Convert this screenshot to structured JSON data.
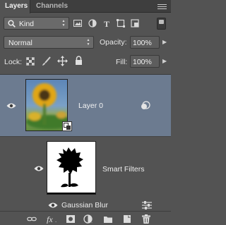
{
  "tabs": [
    {
      "label": "Layers"
    },
    {
      "label": "Channels"
    }
  ],
  "filter": {
    "kind_label": "Kind",
    "icon": "search-icon"
  },
  "blend": {
    "mode": "Normal",
    "opacity_label": "Opacity:",
    "opacity_value": "100%"
  },
  "lock": {
    "label": "Lock:",
    "fill_label": "Fill:",
    "fill_value": "100%"
  },
  "layers": [
    {
      "name": "Layer 0",
      "type": "smart-object",
      "selected": true
    }
  ],
  "smart_filters": {
    "label": "Smart Filters",
    "filters": [
      {
        "name": "Gaussian Blur"
      }
    ]
  },
  "colors": {
    "panel": "#535353",
    "selected_row": "#6c7b90",
    "tab_bar": "#3e3e3e"
  }
}
